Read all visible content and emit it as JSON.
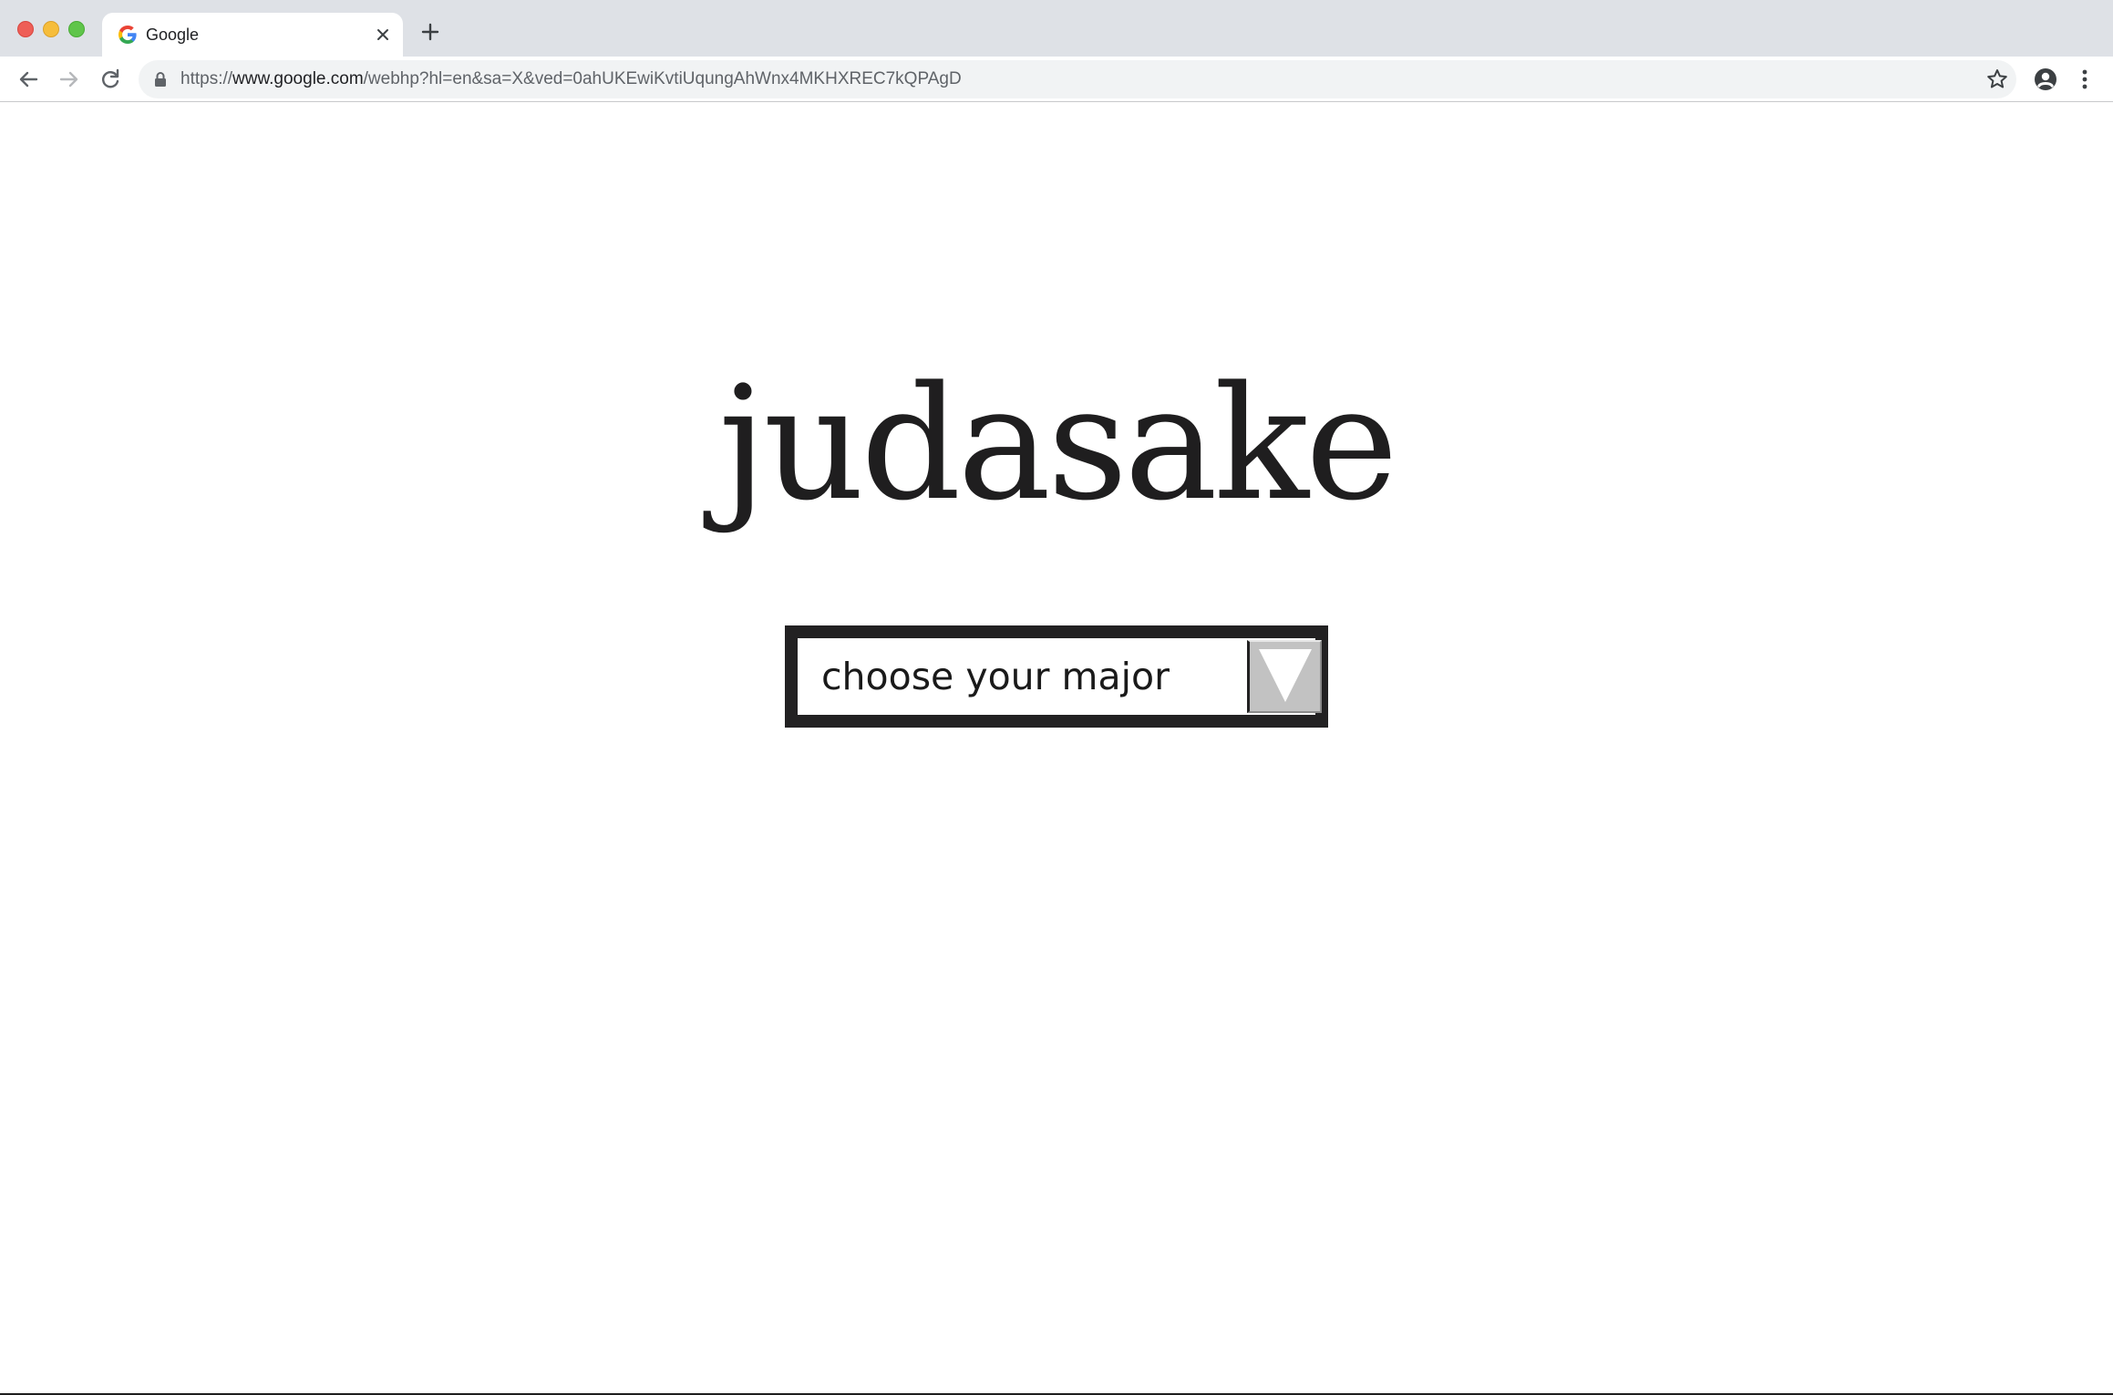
{
  "browser": {
    "tab": {
      "title": "Google",
      "favicon": "google-g-icon"
    },
    "address_bar": {
      "scheme": "https://",
      "host": "www.google.com",
      "path": "/webhp?hl=en&sa=X&ved=0ahUKEwiKvtiUqungAhWnx4MKHXREC7kQPAgD"
    },
    "icons": {
      "back": "arrow-left-icon",
      "forward": "arrow-right-icon",
      "reload": "reload-icon",
      "lock": "lock-icon",
      "bookmark": "star-icon",
      "profile": "account-circle-icon",
      "menu": "vertical-dots-icon",
      "new_tab": "plus-icon",
      "close_tab": "close-icon"
    },
    "colors": {
      "tabstrip": "#dee1e6",
      "traffic_close": "#ee5e57",
      "traffic_minimize": "#f6bd3b",
      "traffic_maximize": "#5fc54a"
    }
  },
  "page": {
    "logo_text": "judasake",
    "major_select": {
      "selected_value": "choose your major",
      "arrow_icon": "triangle-down-icon"
    },
    "colors": {
      "logo": "#1f1e1f",
      "select_border": "#222122",
      "select_arrow_bg": "#c2c2c2"
    }
  }
}
